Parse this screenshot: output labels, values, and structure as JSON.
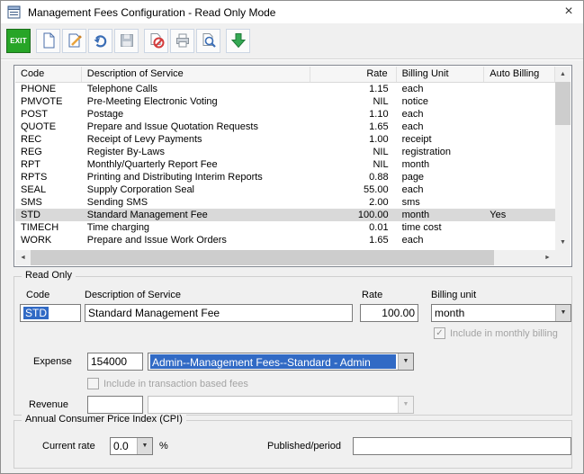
{
  "window": {
    "title": "Management Fees Configuration - Read Only Mode"
  },
  "toolbar": {
    "exit": "EXIT"
  },
  "icons": {
    "close": "×",
    "dropdown": "▼",
    "scroll_up": "▲",
    "scroll_down": "▼",
    "scroll_left": "◄",
    "scroll_right": "►",
    "check": "✓"
  },
  "table": {
    "columns": [
      "Code",
      "Description of Service",
      "Rate",
      "Billing Unit",
      "Auto Billing"
    ],
    "selected_code": "STD",
    "rows": [
      {
        "code": "PHONE",
        "description": "Telephone Calls",
        "rate": "1.15",
        "unit": "each",
        "auto": ""
      },
      {
        "code": "PMVOTE",
        "description": "Pre-Meeting Electronic Voting",
        "rate": "NIL",
        "unit": "notice",
        "auto": ""
      },
      {
        "code": "POST",
        "description": "Postage",
        "rate": "1.10",
        "unit": "each",
        "auto": ""
      },
      {
        "code": "QUOTE",
        "description": "Prepare and Issue Quotation Requests",
        "rate": "1.65",
        "unit": "each",
        "auto": ""
      },
      {
        "code": "REC",
        "description": "Receipt of Levy Payments",
        "rate": "1.00",
        "unit": "receipt",
        "auto": ""
      },
      {
        "code": "REG",
        "description": "Register By-Laws",
        "rate": "NIL",
        "unit": "registration",
        "auto": ""
      },
      {
        "code": "RPT",
        "description": "Monthly/Quarterly Report Fee",
        "rate": "NIL",
        "unit": "month",
        "auto": ""
      },
      {
        "code": "RPTS",
        "description": "Printing and Distributing Interim Reports",
        "rate": "0.88",
        "unit": "page",
        "auto": ""
      },
      {
        "code": "SEAL",
        "description": "Supply Corporation Seal",
        "rate": "55.00",
        "unit": "each",
        "auto": ""
      },
      {
        "code": "SMS",
        "description": "Sending SMS",
        "rate": "2.00",
        "unit": "sms",
        "auto": ""
      },
      {
        "code": "STD",
        "description": "Standard Management Fee",
        "rate": "100.00",
        "unit": "month",
        "auto": "Yes"
      },
      {
        "code": "TIMECH",
        "description": "Time charging",
        "rate": "0.01",
        "unit": "time cost",
        "auto": ""
      },
      {
        "code": "WORK",
        "description": "Prepare and Issue Work Orders",
        "rate": "1.65",
        "unit": "each",
        "auto": ""
      }
    ]
  },
  "read_only": {
    "group_label": "Read Only",
    "code_label": "Code",
    "code_value": "STD",
    "description_label": "Description of Service",
    "description_value": "Standard Management Fee",
    "rate_label": "Rate",
    "rate_value": "100.00",
    "billing_unit_label": "Billing unit",
    "billing_unit_value": "month",
    "include_monthly_label": "Include in monthly billing",
    "include_monthly_checked": true,
    "expense_label": "Expense",
    "expense_code": "154000",
    "expense_account": "Admin--Management Fees--Standard - Admin",
    "include_transaction_label": "Include in transaction based fees",
    "include_transaction_checked": false,
    "revenue_label": "Revenue",
    "revenue_code": "",
    "revenue_account": ""
  },
  "cpi": {
    "group_label": "Annual Consumer Price Index (CPI)",
    "current_rate_label": "Current rate",
    "current_rate_value": "0.0",
    "percent": "%",
    "published_label": "Published/period",
    "published_value": ""
  },
  "colors": {
    "selection": "#316ac5",
    "row_highlight": "#d9d9d9",
    "exit_green": "#27a527"
  }
}
